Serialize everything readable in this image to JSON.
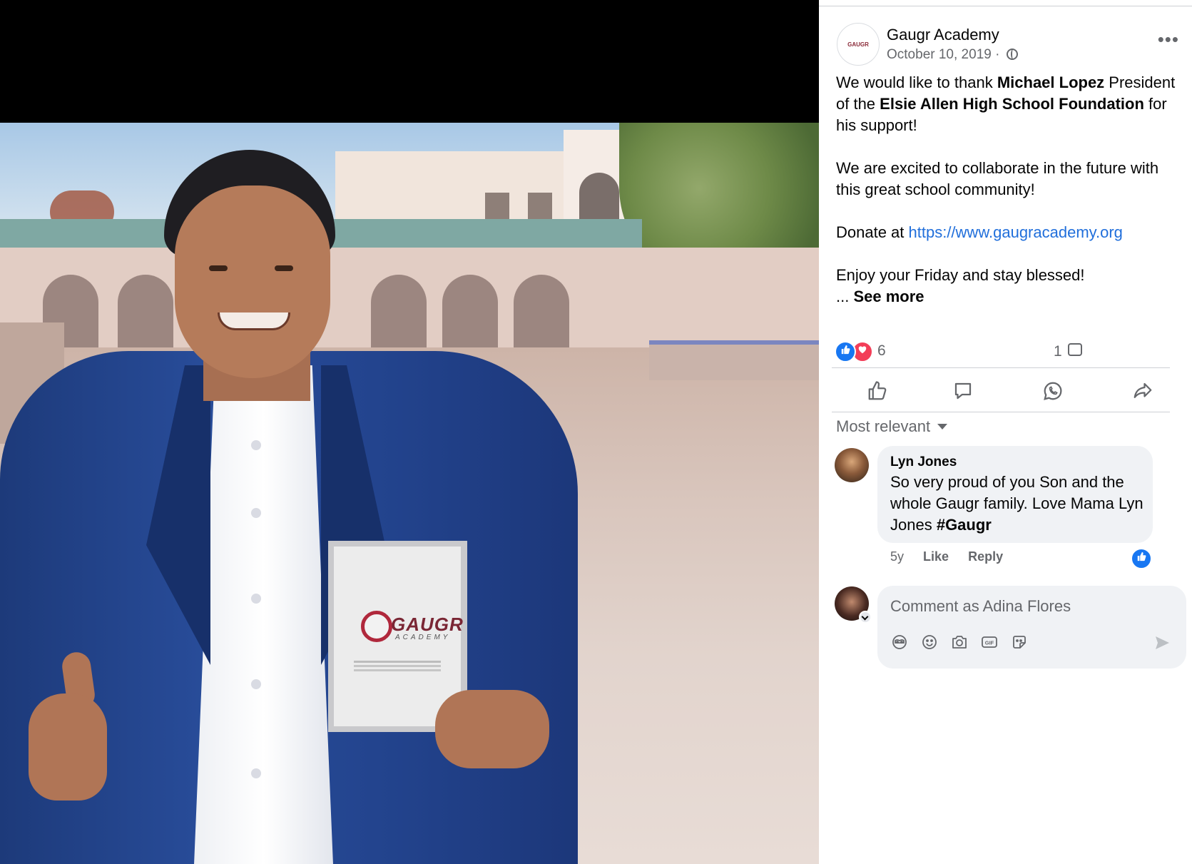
{
  "post": {
    "page_name": "Gaugr Academy",
    "date": "October 10, 2019",
    "date_separator": "·",
    "avatar_text": "GAUGR",
    "more_label": "•••",
    "text_parts": {
      "p1_a": "We would like to thank ",
      "p1_name": "Michael Lopez",
      "p1_b": " President of the ",
      "p1_org": "Elsie Allen High School Foundation",
      "p1_c": " for his support!",
      "p2": "We are excited to collaborate in the future with this great school community!",
      "p3_a": "Donate at ",
      "p3_link": "https://www.gaugracademy.org",
      "p4": "Enjoy your Friday and stay blessed!",
      "ellipsis": "... ",
      "see_more": "See more"
    }
  },
  "photo": {
    "card_logo": "GAUGR",
    "card_logo_sub": "ACADEMY"
  },
  "engagement": {
    "reaction_count": "6",
    "comment_count": "1",
    "reactions": [
      "like-icon",
      "love-icon"
    ],
    "actions": [
      "like-icon",
      "comment-icon",
      "whatsapp-icon",
      "share-icon"
    ]
  },
  "comments": {
    "sort_label": "Most relevant",
    "items": [
      {
        "author": "Lyn Jones",
        "text": "So very proud of you Son and the whole Gaugr family. Love Mama Lyn Jones ",
        "hashtag": "#Gaugr",
        "age": "5y",
        "like_label": "Like",
        "reply_label": "Reply"
      }
    ],
    "compose": {
      "placeholder": "Comment as Adina Flores",
      "tools": [
        "avatar-sticker-icon",
        "emoji-icon",
        "camera-icon",
        "gif-icon",
        "sticker-icon"
      ]
    }
  },
  "colors": {
    "accent": "#1877f2",
    "link": "#216fdb",
    "love": "#f33e58",
    "muted_text": "#65676b",
    "bubble_bg": "#f0f2f5"
  }
}
